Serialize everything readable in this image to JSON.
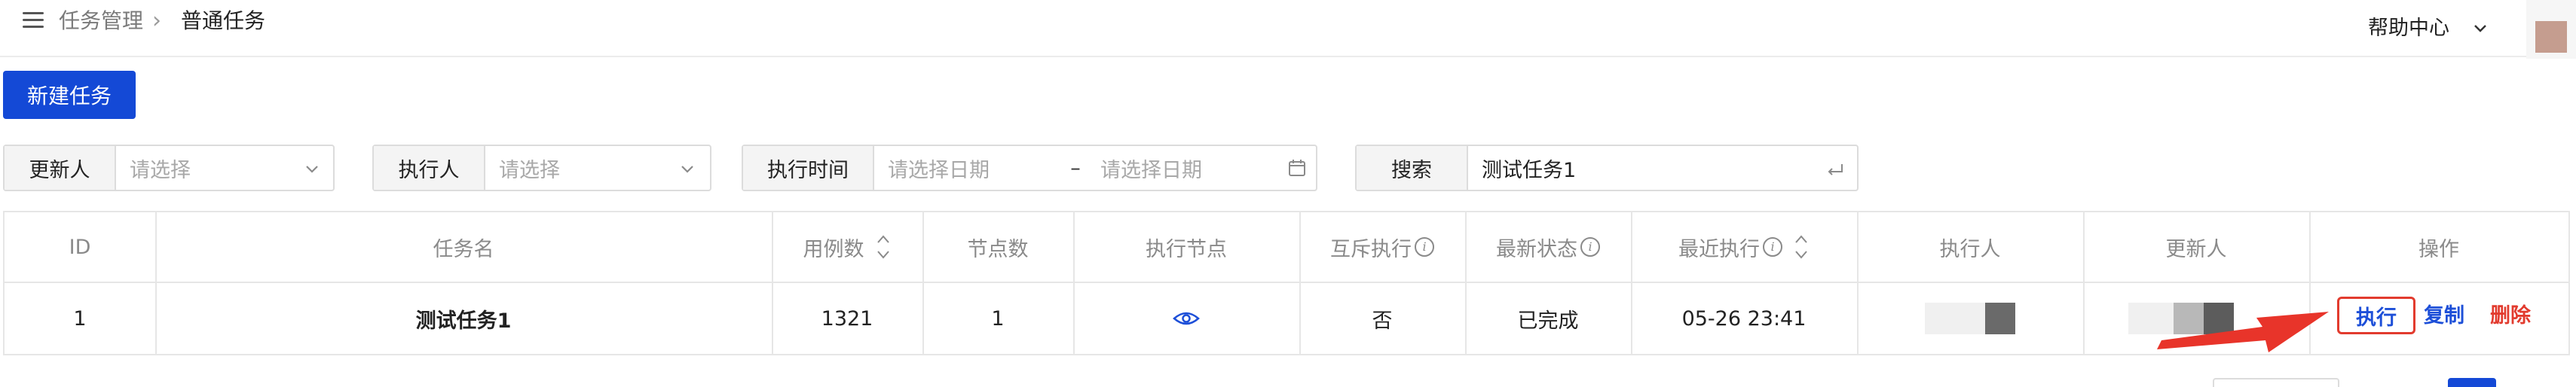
{
  "header": {
    "breadcrumb": [
      "任务管理",
      "普通任务"
    ],
    "breadcrumb_sep": "›",
    "help": "帮助中心"
  },
  "toolbar": {
    "new_task": "新建任务"
  },
  "filters": {
    "updater": {
      "label": "更新人",
      "placeholder": "请选择"
    },
    "executor": {
      "label": "执行人",
      "placeholder": "请选择"
    },
    "exec_time": {
      "label": "执行时间",
      "start_placeholder": "请选择日期",
      "range_sep": "–",
      "end_placeholder": "请选择日期"
    },
    "search": {
      "label": "搜索",
      "value": "测试任务1"
    }
  },
  "table": {
    "columns": [
      "ID",
      "任务名",
      "用例数",
      "节点数",
      "执行节点",
      "互斥执行",
      "最新状态",
      "最近执行",
      "执行人",
      "更新人",
      "操作"
    ],
    "rows": [
      {
        "id": "1",
        "name": "测试任务1",
        "case_count": "1321",
        "node_count": "1",
        "mutex": "否",
        "status": "已完成",
        "last_exec": "05-26 23:41"
      }
    ],
    "actions": {
      "exec": "执行",
      "copy": "复制",
      "delete": "删除"
    }
  },
  "colors": {
    "primary": "#1449d6",
    "link": "#1d4fd8",
    "success": "#1f8a4c",
    "danger": "#e23b2e"
  },
  "icons": [
    "menu-icon",
    "chevron-right-icon",
    "chevron-down-icon",
    "calendar-icon",
    "enter-icon",
    "sort-icon",
    "info-icon",
    "eye-icon",
    "arrow-annotation"
  ]
}
